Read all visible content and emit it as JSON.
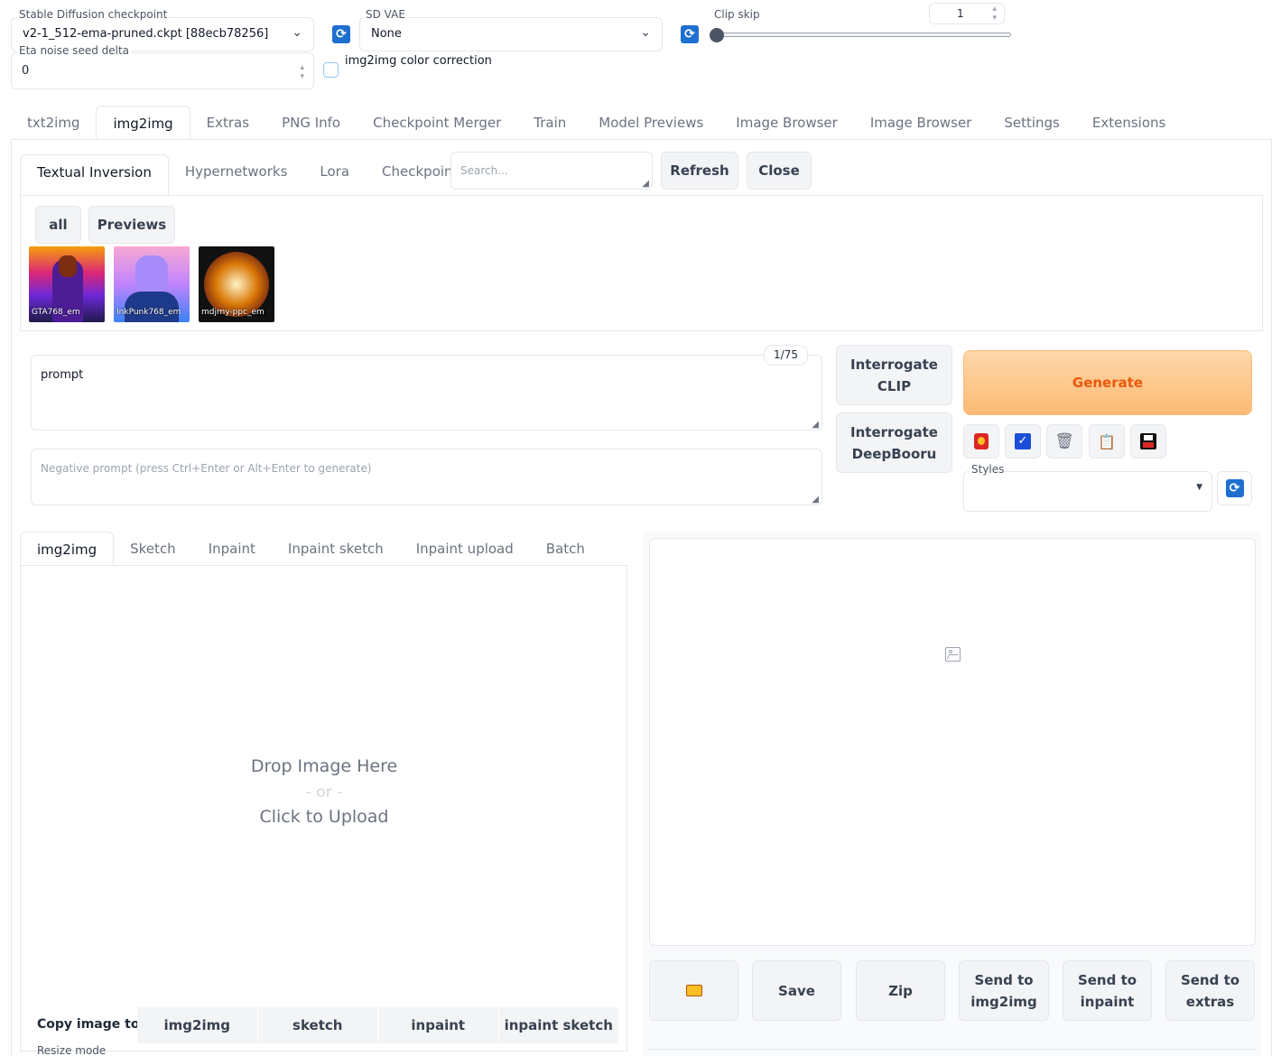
{
  "settings_bar": {
    "checkpoint_label": "Stable Diffusion checkpoint",
    "checkpoint_value": "v2-1_512-ema-pruned.ckpt [88ecb78256]",
    "vae_label": "SD VAE",
    "vae_value": "None",
    "clip_skip_label": "Clip skip",
    "clip_skip_value": "1",
    "eta_label": "Eta noise seed delta",
    "eta_value": "0",
    "color_correction_label": "img2img color correction"
  },
  "main_tabs": [
    "txt2img",
    "img2img",
    "Extras",
    "PNG Info",
    "Checkpoint Merger",
    "Train",
    "Model Previews",
    "Image Browser",
    "Image Browser",
    "Settings",
    "Extensions"
  ],
  "networks": {
    "tabs": [
      "Textual Inversion",
      "Hypernetworks",
      "Lora",
      "Checkpoints"
    ],
    "search_placeholder": "Search...",
    "refresh_label": "Refresh",
    "close_label": "Close",
    "filter_all": "all",
    "filter_previews": "Previews",
    "cards": [
      {
        "name": "GTA768_em"
      },
      {
        "name": "InkPunk768_em"
      },
      {
        "name": "mdjrny-ppc_em"
      }
    ]
  },
  "prompt": {
    "token_count": "1/75",
    "value": "prompt",
    "negative_placeholder": "Negative prompt (press Ctrl+Enter or Alt+Enter to generate)"
  },
  "interrogate": {
    "clip_line1": "Interrogate",
    "clip_line2": "CLIP",
    "deepbooru_line1": "Interrogate",
    "deepbooru_line2": "DeepBooru"
  },
  "generate_label": "Generate",
  "styles_label": "Styles",
  "tool_icons": [
    "extra-networks-icon",
    "checkbox-icon",
    "trash-icon",
    "clipboard-icon",
    "save-icon"
  ],
  "input_tabs": [
    "img2img",
    "Sketch",
    "Inpaint",
    "Inpaint sketch",
    "Inpaint upload",
    "Batch"
  ],
  "upload": {
    "line1": "Drop Image Here",
    "line2": "- or -",
    "line3": "Click to Upload"
  },
  "copy_image": {
    "label": "Copy image to:",
    "targets": [
      "img2img",
      "sketch",
      "inpaint",
      "inpaint sketch"
    ]
  },
  "resize_mode_label": "Resize mode",
  "output_buttons": {
    "folder_icon": "folder-icon",
    "save": "Save",
    "zip": "Zip",
    "send_img2img_line1": "Send to",
    "send_img2img_line2": "img2img",
    "send_inpaint_line1": "Send to",
    "send_inpaint_line2": "inpaint",
    "send_extras_line1": "Send to",
    "send_extras_line2": "extras"
  },
  "colors": {
    "accent": "#1e6fd0",
    "generate_bg_start": "#fed7aa",
    "generate_bg_end": "#fdba74",
    "generate_text": "#ea580c"
  }
}
